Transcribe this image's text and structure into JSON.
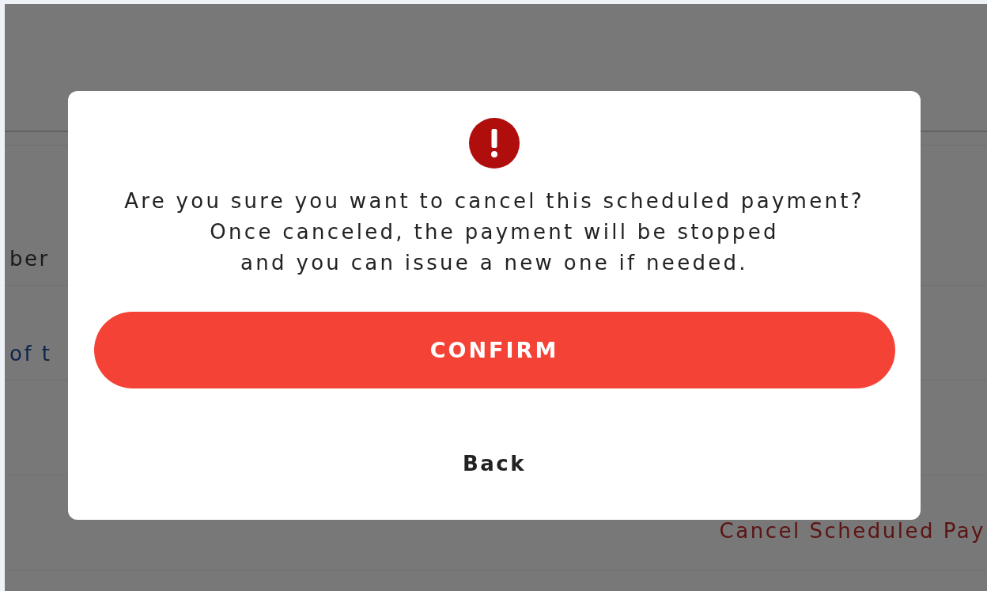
{
  "background_page": {
    "rows": [
      {
        "kind": "plain",
        "text": "ber"
      },
      {
        "kind": "link",
        "text": "of t"
      },
      {
        "kind": "empty"
      },
      {
        "kind": "action",
        "text": "Cancel Scheduled Pay"
      },
      {
        "kind": "empty"
      }
    ]
  },
  "dialog": {
    "message": "Are you sure you want to cancel this scheduled payment?\nOnce canceled, the payment will be stopped\nand you can issue a new one if needed.",
    "confirm_button": "CONFIRM",
    "back_button": "Back"
  }
}
